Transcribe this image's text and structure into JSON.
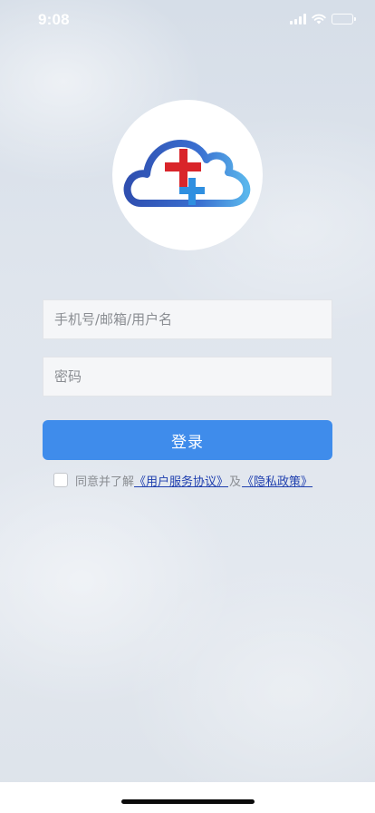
{
  "status_bar": {
    "time": "9:08",
    "icons": [
      "signal-icon",
      "wifi-icon",
      "battery-icon"
    ],
    "battery_level": 0.9
  },
  "logo": {
    "icon": "cloud-medical-cross-icon",
    "colors": {
      "cloud": "#3a62c2",
      "cross_red": "#d9252a",
      "cross_blue": "#2f8fe0"
    }
  },
  "form": {
    "account_placeholder": "手机号/邮箱/用户名",
    "password_placeholder": "密码",
    "login_label": "登录"
  },
  "agreement": {
    "prefix": "同意并了解",
    "terms_link": "《用户服务协议》",
    "and": "及",
    "privacy_link": "《隐私政策》"
  },
  "colors": {
    "accent": "#3f8ceb",
    "link": "#1f3fae"
  }
}
